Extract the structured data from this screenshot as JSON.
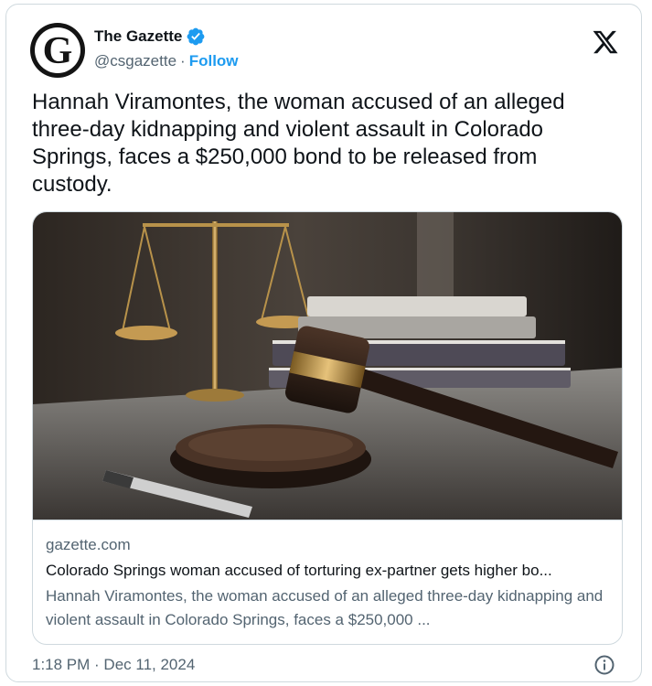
{
  "author": {
    "display_name": "The Gazette",
    "avatar_letter": "G",
    "handle": "@csgazette",
    "separator": "·",
    "follow_label": "Follow",
    "verified_icon": "verified-badge-icon"
  },
  "platform_icon": "x-logo-icon",
  "tweet": {
    "text": "Hannah Viramontes, the woman accused of an alleged three-day kidnapping and violent assault in Colorado Springs, faces a $250,000 bond to be released from custody."
  },
  "link_card": {
    "image_subject": "judge gavel, brass scales of justice, stacked books and pen on a desk",
    "domain": "gazette.com",
    "title": "Colorado Springs woman accused of torturing ex-partner gets higher bo...",
    "description": "Hannah Viramontes, the woman accused of an alleged three-day kidnapping and violent assault in Colorado Springs, faces a $250,000 ..."
  },
  "footer": {
    "timestamp": "1:18 PM · Dec 11, 2024",
    "info_icon": "info-icon"
  },
  "colors": {
    "accent": "#1d9bf0",
    "secondary_text": "#536471",
    "border": "#cfd9de",
    "primary_text": "#0f1419"
  }
}
